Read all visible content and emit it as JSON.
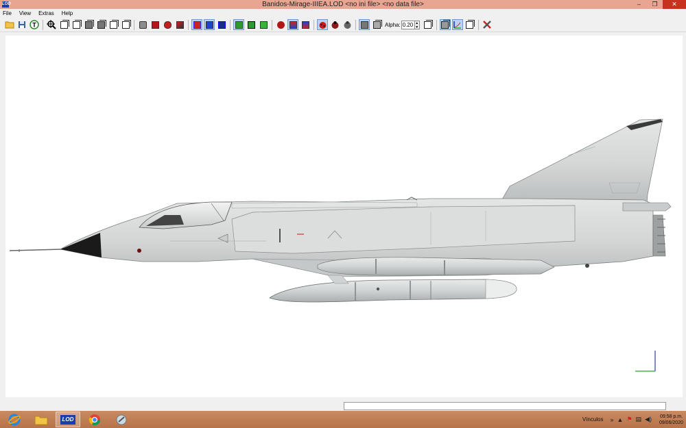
{
  "window": {
    "app_icon_text": "LOD",
    "title": "Banidos-Mirage-IIIEA.LOD  <no ini file>  <no data file>",
    "controls": {
      "minimize": "–",
      "maximize": "❐",
      "close": "✕"
    }
  },
  "menu": [
    "File",
    "View",
    "Extras",
    "Help"
  ],
  "toolbar": {
    "alpha_label": "Alpha:",
    "alpha_value": "0.20"
  },
  "status": {
    "text": ""
  },
  "taskbar": {
    "apps": [
      {
        "name": "internet-explorer",
        "icon": "e"
      },
      {
        "name": "file-explorer",
        "icon": "folder"
      },
      {
        "name": "lod-viewer",
        "icon": "LOD"
      },
      {
        "name": "chrome",
        "icon": "chrome"
      },
      {
        "name": "app-misc",
        "icon": "misc"
      }
    ],
    "tray_links": "Vínculos",
    "tray_chevron": "»",
    "time": "09:58 p.m.",
    "date": "09/06/2020"
  },
  "colors": {
    "titlebar": "#e8a592",
    "close": "#c7311f",
    "taskbar": "#b77349",
    "aircraft_body": "#d6d8d8",
    "radome": "#1a1a1a"
  }
}
